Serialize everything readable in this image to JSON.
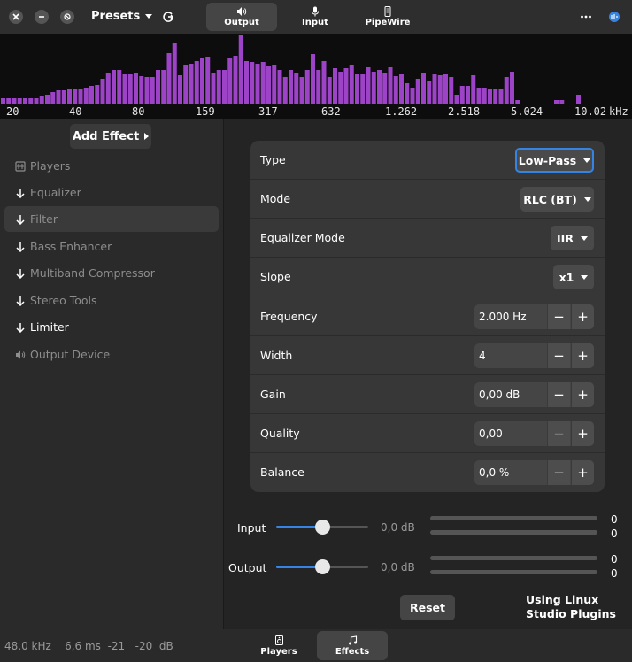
{
  "header": {
    "presets_label": "Presets",
    "tabs": [
      {
        "label": "Output",
        "icon": "speaker-icon",
        "active": true
      },
      {
        "label": "Input",
        "icon": "microphone-icon",
        "active": false
      },
      {
        "label": "PipeWire",
        "icon": "pipewire-icon",
        "active": false
      }
    ]
  },
  "spectrum": {
    "color": "#9d43c7",
    "freq_labels": [
      "20",
      "40",
      "80",
      "159",
      "317",
      "632",
      "1.262",
      "2.518",
      "5.024",
      "10.02",
      "kHz"
    ],
    "bars": [
      6,
      6,
      6,
      6,
      6,
      6,
      6,
      8,
      10,
      13,
      15,
      15,
      17,
      17,
      17,
      18,
      20,
      21,
      28,
      35,
      38,
      38,
      33,
      33,
      35,
      31,
      30,
      30,
      38,
      38,
      57,
      68,
      32,
      44,
      45,
      48,
      52,
      53,
      35,
      38,
      38,
      52,
      54,
      78,
      48,
      47,
      45,
      47,
      42,
      43,
      38,
      30,
      38,
      34,
      30,
      38,
      56,
      38,
      48,
      30,
      40,
      36,
      40,
      43,
      33,
      33,
      41,
      36,
      38,
      34,
      41,
      31,
      33,
      23,
      18,
      28,
      35,
      25,
      33,
      32,
      33,
      30,
      10,
      20,
      20,
      32,
      18,
      18,
      16,
      16,
      16,
      30,
      36,
      4,
      0,
      0,
      0,
      0,
      0,
      0,
      4,
      4,
      0,
      0,
      10,
      0,
      0,
      0,
      0,
      0,
      0,
      0,
      0
    ]
  },
  "sidebar": {
    "add_effect_label": "Add Effect",
    "items": [
      {
        "label": "Players",
        "icon": "players-icon"
      },
      {
        "label": "Equalizer",
        "icon": "arrow-down-icon"
      },
      {
        "label": "Filter",
        "icon": "arrow-down-icon"
      },
      {
        "label": "Bass Enhancer",
        "icon": "arrow-down-icon"
      },
      {
        "label": "Multiband Compressor",
        "icon": "arrow-down-icon"
      },
      {
        "label": "Stereo Tools",
        "icon": "arrow-down-icon"
      },
      {
        "label": "Limiter",
        "icon": "arrow-down-icon"
      },
      {
        "label": "Output Device",
        "icon": "speaker-icon"
      }
    ]
  },
  "filter": {
    "type": {
      "label": "Type",
      "value": "Low-Pass"
    },
    "mode": {
      "label": "Mode",
      "value": "RLC (BT)"
    },
    "equalizer_mode": {
      "label": "Equalizer Mode",
      "value": "IIR"
    },
    "slope": {
      "label": "Slope",
      "value": "x1"
    },
    "frequency": {
      "label": "Frequency",
      "value": "2.000 Hz"
    },
    "width": {
      "label": "Width",
      "value": "4"
    },
    "gain": {
      "label": "Gain",
      "value": "0,00 dB"
    },
    "quality": {
      "label": "Quality",
      "value": "0,00"
    },
    "balance": {
      "label": "Balance",
      "value": "0,0 %"
    }
  },
  "levels": {
    "input": {
      "label": "Input",
      "db": "0,0 dB",
      "meter_values": [
        "0",
        "0"
      ],
      "slider_level": 0.5
    },
    "output": {
      "label": "Output",
      "db": "0,0 dB",
      "meter_values": [
        "0",
        "0"
      ],
      "slider_level": 0.5
    }
  },
  "reset_label": "Reset",
  "lsp_label": "Using Linux Studio Plugins",
  "statusbar": {
    "sample_rate": "48,0 kHz",
    "latency": "6,6 ms",
    "peak_left": "-21",
    "peak_right": "-20",
    "unit": "dB"
  },
  "bottom_tabs": [
    {
      "label": "Players",
      "icon": "players-icon",
      "active": false
    },
    {
      "label": "Effects",
      "icon": "music-note-icon",
      "active": true
    }
  ],
  "colors": {
    "accent": "#3584e4",
    "spectrum": "#9d43c7"
  }
}
